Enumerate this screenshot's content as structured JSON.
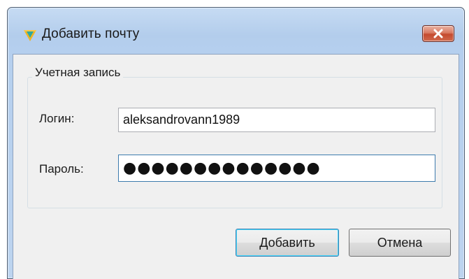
{
  "window": {
    "title": "Добавить почту"
  },
  "icons": {
    "app": "app-logo-icon",
    "close": "close-icon"
  },
  "colors": {
    "close_button": "#c44a2f",
    "frame": "#b5cfee",
    "focus_border": "#3d7bad"
  },
  "account_group": {
    "legend": "Учетная запись",
    "login": {
      "label": "Логин:",
      "value": "aleksandrovann1989"
    },
    "password": {
      "label": "Пароль:",
      "value": "●●●●●●●●●●●●●●"
    }
  },
  "buttons": {
    "add": "Добавить",
    "cancel": "Отмена"
  }
}
